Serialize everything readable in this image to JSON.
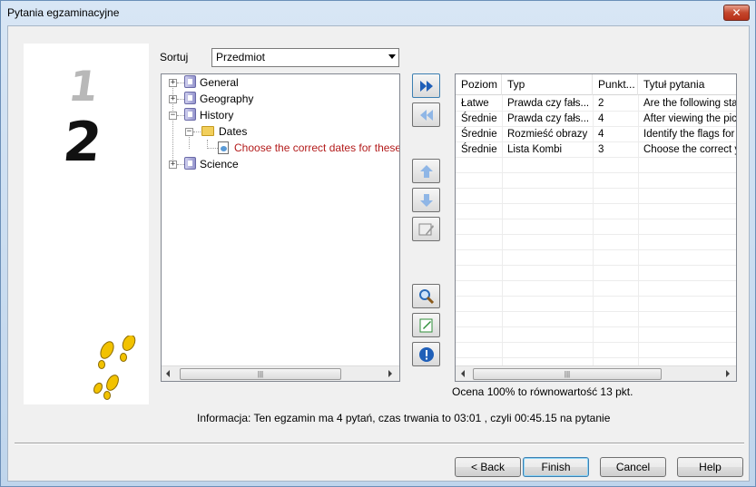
{
  "window": {
    "title": "Pytania egzaminacyjne",
    "close_label": "✕"
  },
  "wizard": {
    "step_done": "1",
    "step_current": "2"
  },
  "sort": {
    "label": "Sortuj",
    "value": "Przedmiot"
  },
  "tree": {
    "nodes": [
      {
        "label": "General",
        "expanded": false
      },
      {
        "label": "Geography",
        "expanded": false
      },
      {
        "label": "History",
        "expanded": true
      },
      {
        "label": "Dates",
        "expanded": true
      },
      {
        "label": "Choose the correct dates for these fa"
      },
      {
        "label": "Science",
        "expanded": false
      }
    ]
  },
  "toolbar": {
    "add_all": "add-all-icon",
    "remove_all": "remove-all-icon",
    "move_up": "arrow-up-icon",
    "move_down": "arrow-down-icon",
    "edit": "edit-question-icon",
    "preview": "magnifier-icon",
    "notes": "notepad-icon",
    "info": "info-icon"
  },
  "grid": {
    "columns": [
      "Poziom",
      "Typ",
      "Punkt...",
      "Tytuł pytania"
    ],
    "rows": [
      [
        "Łatwe",
        "Prawda czy fałs...",
        "2",
        "Are the following state"
      ],
      [
        "Średnie",
        "Prawda czy fałs...",
        "4",
        "After viewing the pictu"
      ],
      [
        "Średnie",
        "Rozmieść obrazy",
        "4",
        "Identify the flags for e"
      ],
      [
        "Średnie",
        "Lista Kombi",
        "3",
        "Choose the correct ye"
      ]
    ]
  },
  "score": "Ocena 100% to równowartość 13 pkt.",
  "info": "Informacja: Ten egzamin ma 4 pytań, czas trwania to 03:01  , czyli 00:45.15 na pytanie",
  "buttons": {
    "back": "< Back",
    "finish": "Finish",
    "cancel": "Cancel",
    "help": "Help"
  },
  "colors": {
    "question_text": "#b31b1b",
    "scroll_arrow_icons": "#4a86d4"
  }
}
